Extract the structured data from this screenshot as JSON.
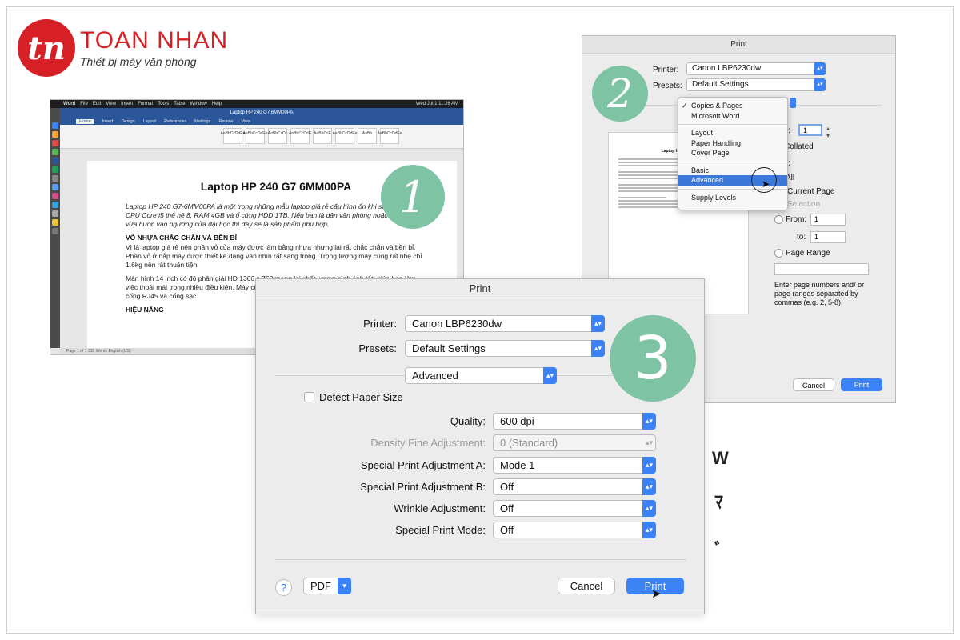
{
  "logo": {
    "mark": "tn",
    "name": "TOAN NHAN",
    "tagline": "Thiết bị máy văn phòng"
  },
  "badges": [
    "1",
    "2",
    "3"
  ],
  "word": {
    "menubar": [
      "Word",
      "File",
      "Edit",
      "View",
      "Insert",
      "Format",
      "Tools",
      "Table",
      "Window",
      "Help"
    ],
    "clock": "Wed Jul 1 11:26 AM",
    "window_title": "Laptop HP 240 G7 6MM00PA",
    "tabs": [
      "Home",
      "Insert",
      "Design",
      "Layout",
      "References",
      "Mailings",
      "Review",
      "View"
    ],
    "styles": [
      "AaBbCcDdEe",
      "AaBbCcDdEe",
      "AaBbCcDc",
      "AaBbCcDdE",
      "AaBbCcE",
      "AaBbCcDdEe",
      "AaBb",
      "AaBbCcDdEe"
    ],
    "doc_title": "Laptop HP 240 G7 6MM00PA",
    "para1": "Laptop HP 240 G7-6MM00PA là một trong những mẫu laptop giá rẻ cấu hình ổn khi sở hữu chip CPU Core i5 thế hệ 8, RAM 4GB và ổ cứng HDD 1TB. Nếu bạn là dân văn phòng hoặc sinh viên vừa bước vào ngưỡng cửa đại học thì đây sẽ là sản phẩm phù hợp.",
    "heading1": "VỎ NHỰA CHẮC CHẮN VÀ BỀN BỈ",
    "para2": "Vì là laptop giá rẻ nên phần vỏ của máy được làm bằng nhựa nhưng lại rất chắc chắn và bền bỉ. Phần vỏ ở nắp máy được thiết kế dạng vân nhìn rất sang trọng. Trọng lượng máy cũng rất nhẹ chỉ 1.6kg nên rất thuận tiện.",
    "para3": "Màn hình 14 inch có độ phân giải HD 1366 x 768 mang lại chất lượng hình ảnh tốt, giúp bạn làm việc thoải mái trong nhiều điều kiện. Máy cũng có đầy đủ các cổng kết nối cơ bản như USB, HDMI, cổng RJ45 và cổng sạc.",
    "heading2": "HIỆU NĂNG",
    "status": "Page 1 of 1    335 Words    English (US)"
  },
  "print_small": {
    "title": "Print",
    "printer_label": "Printer:",
    "printer_value": "Canon LBP6230dw",
    "presets_label": "Presets:",
    "presets_value": "Default Settings",
    "menu": {
      "group1": [
        "Copies & Pages",
        "Microsoft Word"
      ],
      "group2": [
        "Layout",
        "Paper Handling",
        "Cover Page"
      ],
      "group3": [
        "Basic",
        "Advanced"
      ],
      "group4": [
        "Supply Levels"
      ],
      "checked": "Copies & Pages",
      "selected": "Advanced"
    },
    "copies_label": "s:",
    "copies_value": "1",
    "collated": "Collated",
    "s_label": "s:",
    "all": "All",
    "current_page": "Current Page",
    "selection": "Selection",
    "from_label": "From:",
    "from_value": "1",
    "to_label": "to:",
    "to_value": "1",
    "page_range": "Page Range",
    "hint": "Enter page numbers and/ or page ranges separated by commas (e.g. 2, 5-8)",
    "preview_title": "Laptop HP 240 G7",
    "cancel": "Cancel",
    "print": "Print"
  },
  "print_main": {
    "title": "Print",
    "printer_label": "Printer:",
    "printer_value": "Canon LBP6230dw",
    "presets_label": "Presets:",
    "presets_value": "Default Settings",
    "panel_value": "Advanced",
    "detect_paper": "Detect Paper Size",
    "rows": [
      {
        "label": "Quality:",
        "value": "600 dpi",
        "enabled": true
      },
      {
        "label": "Density Fine Adjustment:",
        "value": "0 (Standard)",
        "enabled": false
      },
      {
        "label": "Special Print Adjustment A:",
        "value": "Mode 1",
        "enabled": true
      },
      {
        "label": "Special Print Adjustment B:",
        "value": "Off",
        "enabled": true
      },
      {
        "label": "Wrinkle Adjustment:",
        "value": "Off",
        "enabled": true
      },
      {
        "label": "Special Print Mode:",
        "value": "Off",
        "enabled": true
      }
    ],
    "help": "?",
    "pdf": "PDF",
    "cancel": "Cancel",
    "print": "Print"
  },
  "colors": {
    "brand": "#d71f26",
    "badge": "#7ec3a4",
    "accent": "#3b82f6",
    "selected": "#3b78d8"
  }
}
